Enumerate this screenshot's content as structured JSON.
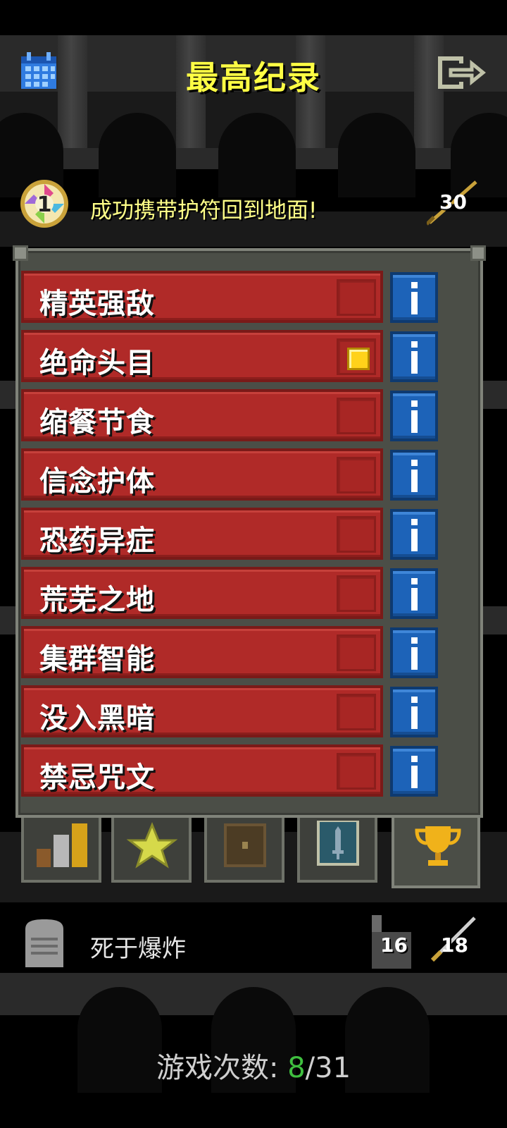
{
  "header": {
    "title": "最高纪录",
    "calendar_icon": "calendar-icon",
    "exit_icon": "exit-icon"
  },
  "victory": {
    "text": "成功携带护符回到地面!",
    "badge_number": "1",
    "depth": "30",
    "badge_icon": "amulet-badge-icon",
    "depth_icon": "depth-stairs-icon"
  },
  "challenges": [
    {
      "label": "精英强敌",
      "enabled": false
    },
    {
      "label": "绝命头目",
      "enabled": true
    },
    {
      "label": "缩餐节食",
      "enabled": false
    },
    {
      "label": "信念护体",
      "enabled": false
    },
    {
      "label": "恐药异症",
      "enabled": false
    },
    {
      "label": "荒芜之地",
      "enabled": false
    },
    {
      "label": "集群智能",
      "enabled": false
    },
    {
      "label": "没入黑暗",
      "enabled": false
    },
    {
      "label": "禁忌咒文",
      "enabled": false
    }
  ],
  "tabs": [
    {
      "icon": "stats-bars-icon",
      "active": false
    },
    {
      "icon": "star-icon",
      "active": false
    },
    {
      "icon": "chest-icon",
      "active": false
    },
    {
      "icon": "sword-card-icon",
      "active": false
    },
    {
      "icon": "trophy-icon",
      "active": true
    }
  ],
  "last_run": {
    "death": "死于爆炸",
    "depth": "16",
    "level": "18"
  },
  "games": {
    "label": "游戏次数:",
    "won": "8",
    "total": "/31"
  },
  "colors": {
    "title": "#ffff44",
    "challenge_bg": "#b02a28",
    "info_bg": "#1d63b8",
    "won_count": "#3fbf3f"
  }
}
